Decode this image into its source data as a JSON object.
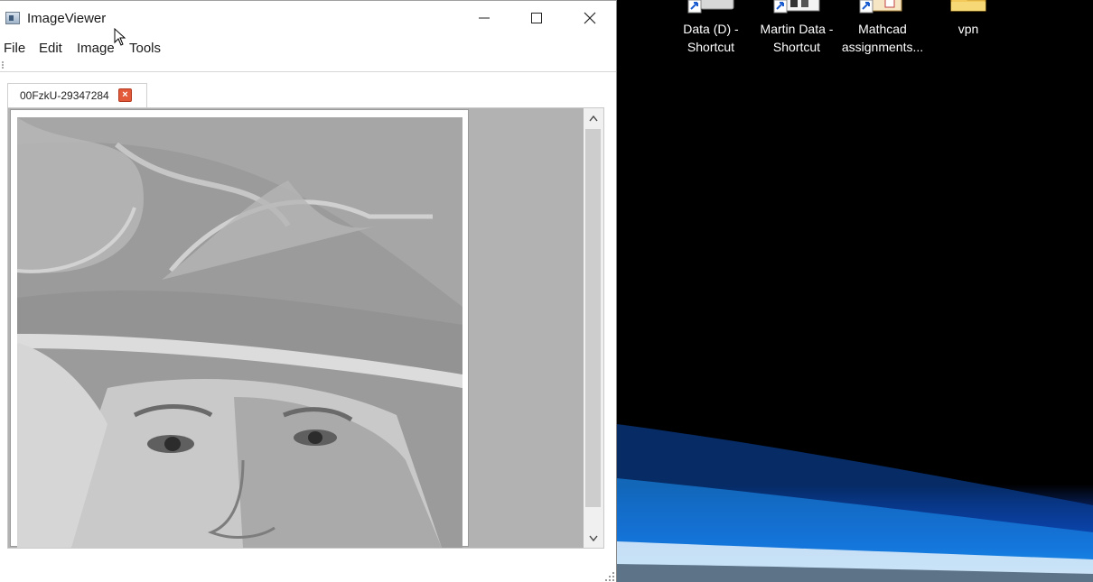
{
  "window": {
    "title": "ImageViewer",
    "controls": {
      "minimize": "minimize",
      "maximize": "maximize",
      "close": "close"
    }
  },
  "menu": {
    "items": [
      "File",
      "Edit",
      "Image",
      "Tools"
    ]
  },
  "tab": {
    "label": "00FzkU-29347284",
    "close_symbol": "×"
  },
  "scrollbar": {
    "up_icon": "chevron-up-icon",
    "down_icon": "chevron-down-icon"
  },
  "desktop": {
    "icons": [
      {
        "line1": "Data (D) -",
        "line2": "Shortcut",
        "icon": "drive-shortcut-icon"
      },
      {
        "line1": "Martin Data -",
        "line2": "Shortcut",
        "icon": "folder-shortcut-icon"
      },
      {
        "line1": "Mathcad",
        "line2": "assignments...",
        "icon": "folder-shortcut-icon"
      },
      {
        "line1": "vpn",
        "line2": "",
        "icon": "folder-icon"
      }
    ]
  },
  "colors": {
    "desktop_bg": "#000000",
    "accent_blue": "#0a3a9a",
    "tab_close": "#e35a3a"
  }
}
